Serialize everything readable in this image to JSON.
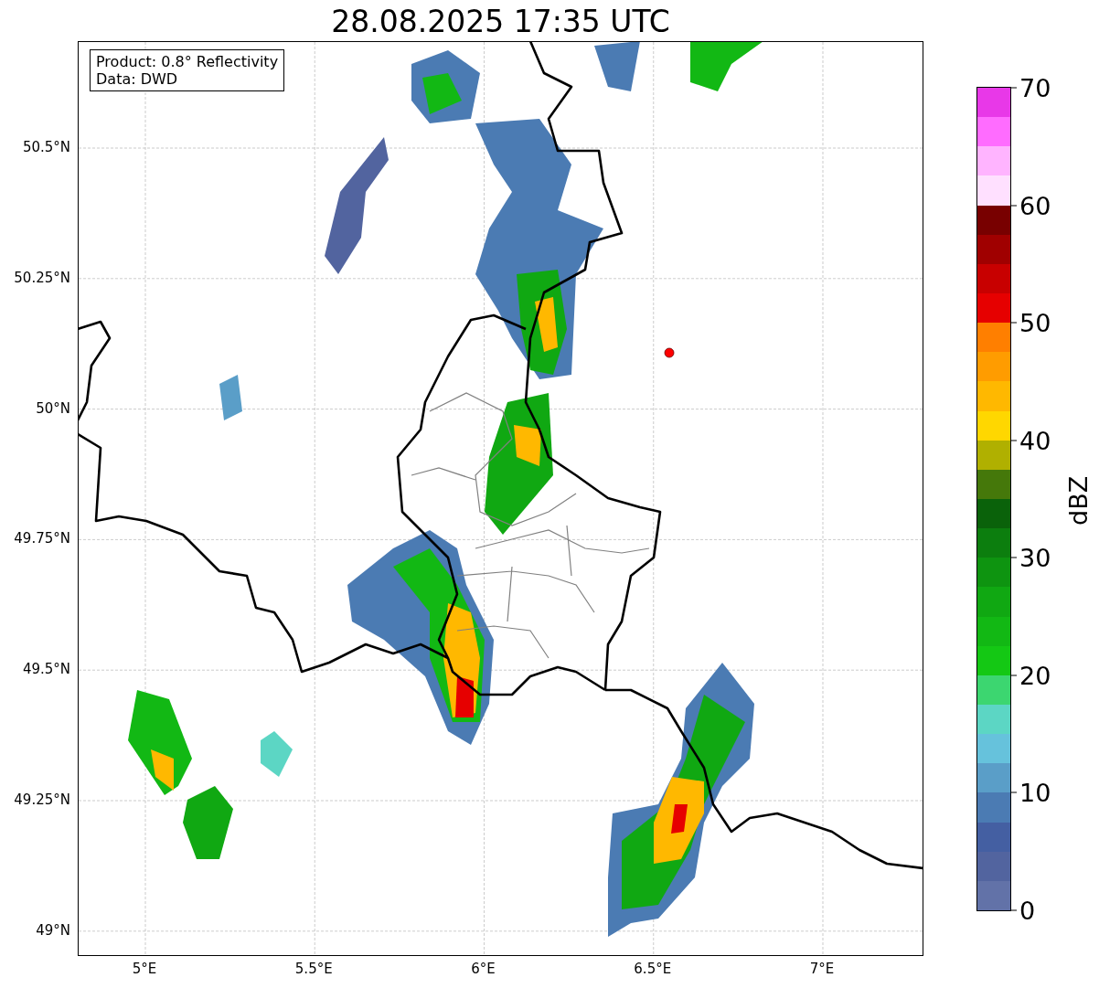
{
  "title": "28.08.2025 17:35 UTC",
  "info_box": [
    "Product: 0.8° Reflectivity",
    "Data: DWD"
  ],
  "y_ticks": [
    "50.5°N",
    "50.25°N",
    "50°N",
    "49.75°N",
    "49.5°N",
    "49.25°N",
    "49°N"
  ],
  "x_ticks": [
    "5°E",
    "5.5°E",
    "6°E",
    "6.5°E",
    "7°E"
  ],
  "colorbar": {
    "ticks": [
      "70",
      "60",
      "50",
      "40",
      "30",
      "20",
      "10",
      "0"
    ],
    "label": "dBZ",
    "segments": [
      {
        "color": "#e838e8"
      },
      {
        "color": "#ff6cff"
      },
      {
        "color": "#ffb4ff"
      },
      {
        "color": "#ffe0ff"
      },
      {
        "color": "#780000"
      },
      {
        "color": "#a00000"
      },
      {
        "color": "#c80000"
      },
      {
        "color": "#e60000"
      },
      {
        "color": "#ff7f00"
      },
      {
        "color": "#ff9c00"
      },
      {
        "color": "#ffb800"
      },
      {
        "color": "#ffd700"
      },
      {
        "color": "#b0b000"
      },
      {
        "color": "#45780a"
      },
      {
        "color": "#0a620a"
      },
      {
        "color": "#0c7e0e"
      },
      {
        "color": "#0e9410"
      },
      {
        "color": "#10a812"
      },
      {
        "color": "#12b814"
      },
      {
        "color": "#14c814"
      },
      {
        "color": "#3cd670"
      },
      {
        "color": "#5cd6c4"
      },
      {
        "color": "#66c2dc"
      },
      {
        "color": "#5a9ec8"
      },
      {
        "color": "#4b7bb3"
      },
      {
        "color": "#445fa2"
      },
      {
        "color": "#52649f"
      },
      {
        "color": "#6272a8"
      }
    ]
  }
}
